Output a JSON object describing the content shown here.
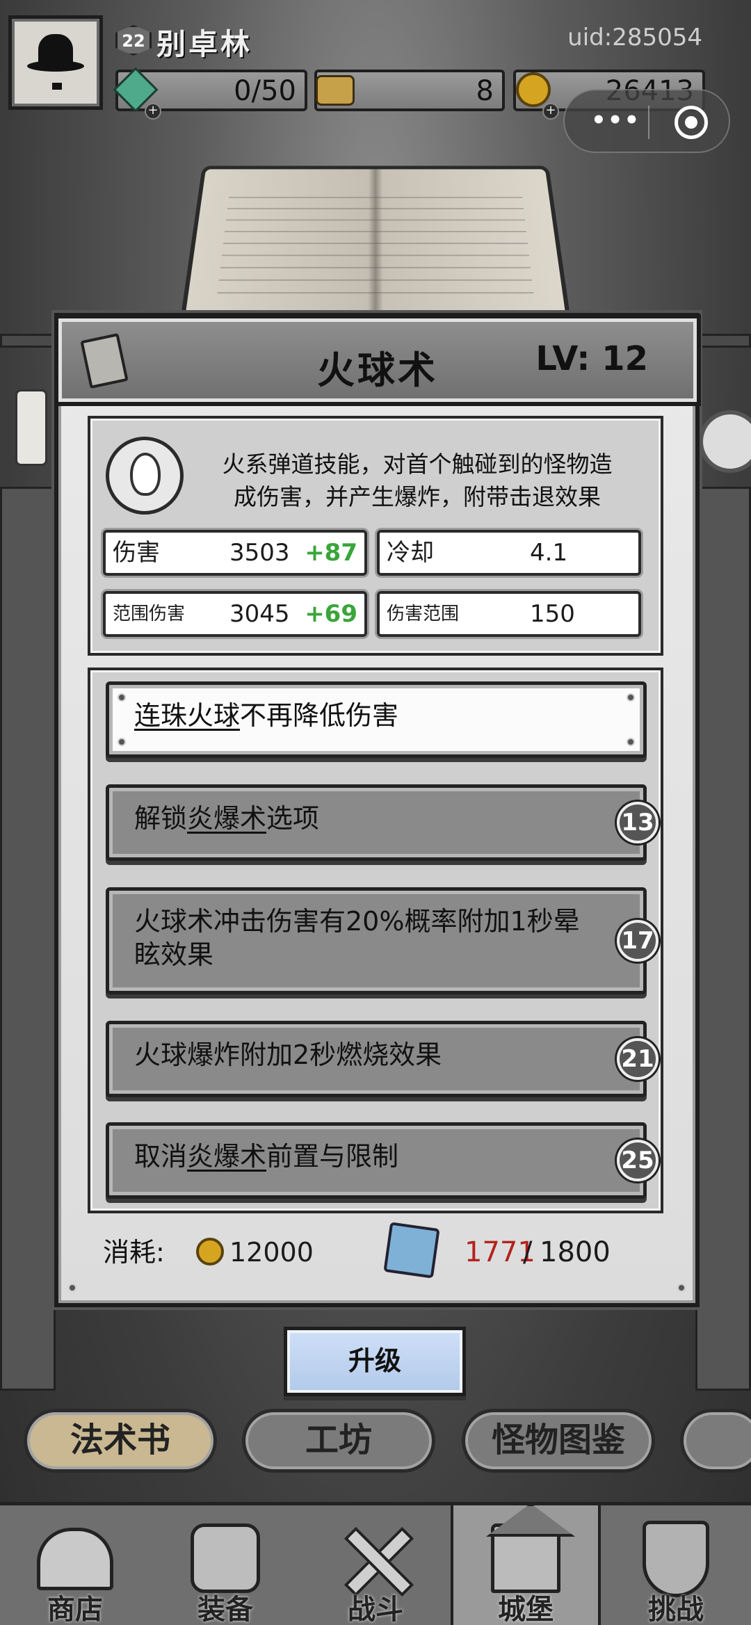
{
  "header": {
    "level": "22",
    "player_name": "别卓林",
    "uid": "uid:285054",
    "energy": "0/50",
    "tickets": "8",
    "gold": "26413"
  },
  "miniprogram_capsule": {
    "more_glyph": "•••"
  },
  "skill": {
    "name": "火球术",
    "level": "LV: 12",
    "description_line1": "火系弹道技能，对首个触碰到的怪物造",
    "description_line2": "成伤害，并产生爆炸，附带击退效果",
    "stats": {
      "damage_label": "伤害",
      "damage_value": "3503",
      "damage_bonus": "+87",
      "cooldown_label": "冷却",
      "cooldown_value": "4.1",
      "aoe_damage_label": "范围伤害",
      "aoe_damage_value": "3045",
      "aoe_damage_bonus": "+69",
      "aoe_range_label": "伤害范围",
      "aoe_range_value": "150"
    }
  },
  "options": [
    {
      "pre": "",
      "link": "连珠火球",
      "post": "不再降低伤害",
      "level": ""
    },
    {
      "pre": "解锁",
      "link": "炎爆术",
      "post": "选项",
      "level": "13"
    },
    {
      "pre": "火球术冲击伤害有20%概率附加1秒晕眩效果",
      "link": "",
      "post": "",
      "level": "17"
    },
    {
      "pre": "火球爆炸附加2秒燃烧效果",
      "link": "",
      "post": "",
      "level": "21"
    },
    {
      "pre": "取消",
      "link": "炎爆术",
      "post": "前置与限制",
      "level": "25"
    }
  ],
  "cost": {
    "label": "消耗:",
    "gold": "12000",
    "shards_have": "1771",
    "shards_slash": "/",
    "shards_need": "1800"
  },
  "upgrade_button": "升级",
  "sub_tabs": [
    "法术书",
    "工坊",
    "怪物图鉴"
  ],
  "bottom_nav": [
    "商店",
    "装备",
    "战斗",
    "城堡",
    "挑战"
  ],
  "colors": {
    "bonus_green": "#3aa53a",
    "shortfall_red": "#b3221e",
    "upgrade_blue": "#b2c9ea",
    "active_tab_tan": "#c9b892"
  }
}
